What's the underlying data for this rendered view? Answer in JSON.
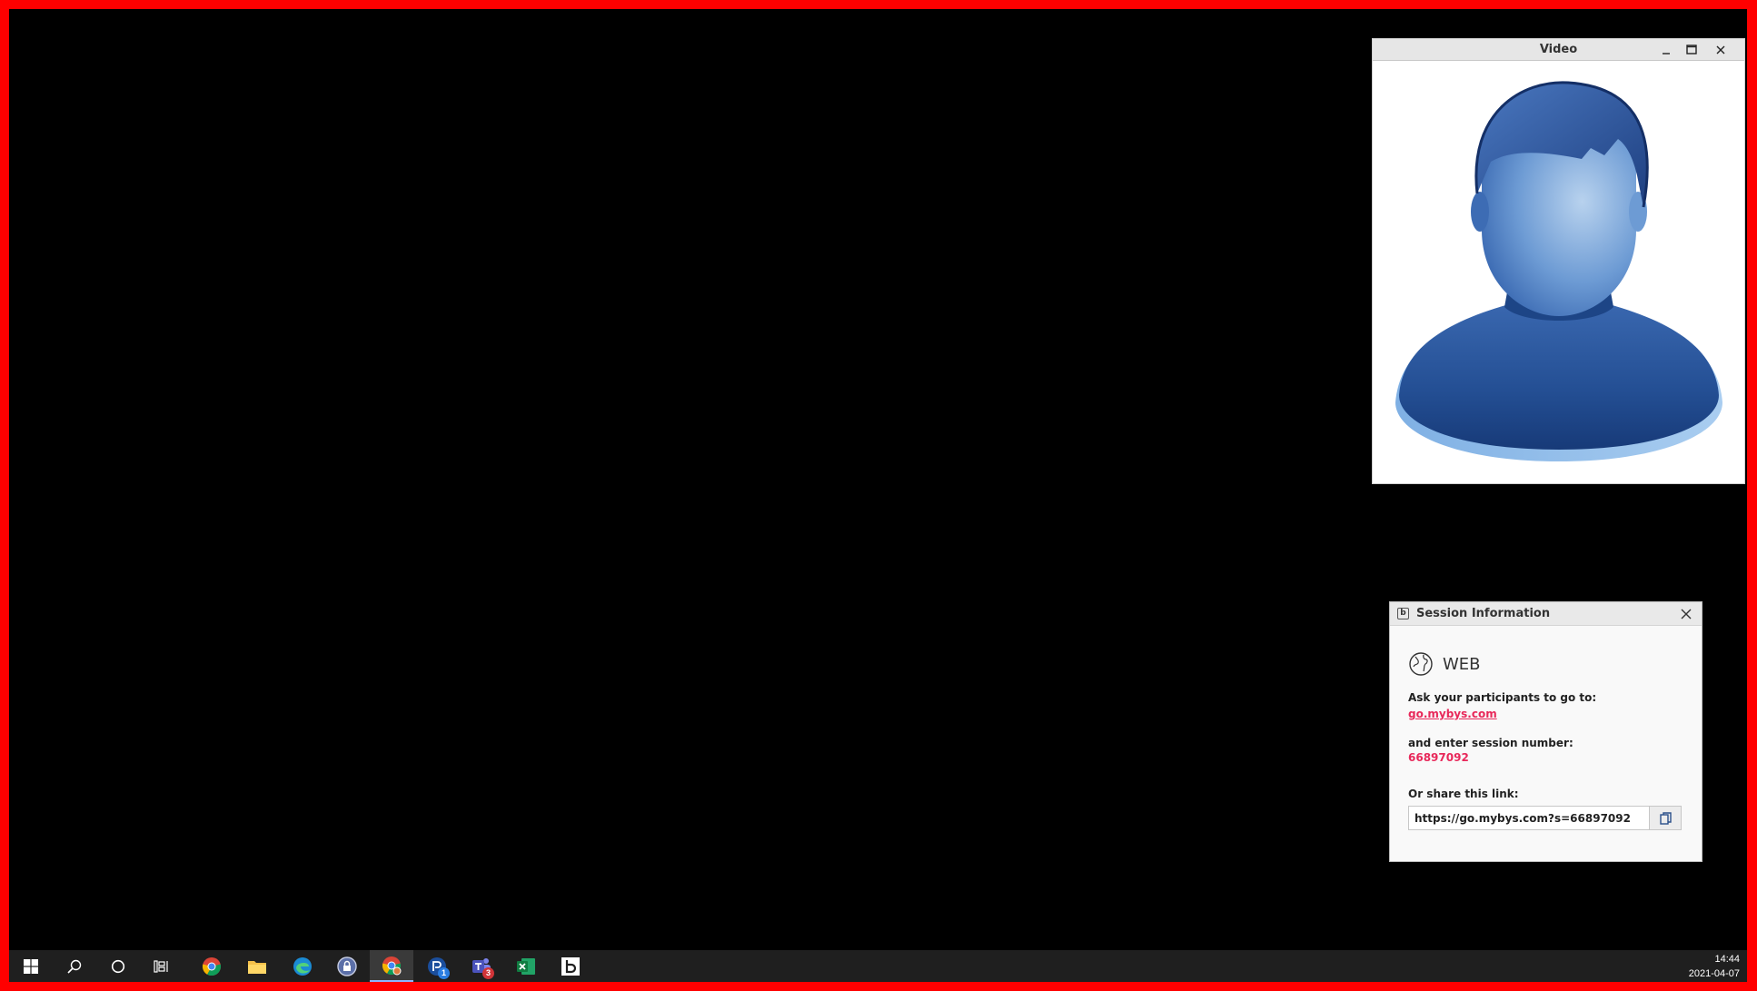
{
  "video_window": {
    "title": "Video",
    "minimize_label": "_",
    "maximize_label": "☐",
    "close_label": "✕"
  },
  "session_window": {
    "title": "Session Information",
    "app_icon_glyph": "b",
    "close_label": "✕",
    "web_label": "WEB",
    "ask_label": "Ask your participants to go to:",
    "site_link": "go.mybys.com",
    "enter_label": "and enter session number:",
    "session_number": "66897092",
    "share_label": "Or share this link:",
    "share_link": "https://go.mybys.com?s=66897092"
  },
  "taskbar": {
    "items": [
      {
        "name": "start-icon"
      },
      {
        "name": "search-icon"
      },
      {
        "name": "cortana-icon"
      },
      {
        "name": "task-view-icon"
      },
      {
        "name": "chrome-icon"
      },
      {
        "name": "file-explorer-icon"
      },
      {
        "name": "edge-icon"
      },
      {
        "name": "security-app-icon"
      },
      {
        "name": "chrome-profile-icon"
      },
      {
        "name": "remote-support-icon",
        "badge": "1"
      },
      {
        "name": "teams-icon",
        "badge": "3"
      },
      {
        "name": "excel-icon"
      },
      {
        "name": "bys-app-icon"
      }
    ],
    "time": "14:44",
    "date": "2021-04-07"
  },
  "colors": {
    "border": "#ff0000",
    "accent": "#e8285a",
    "taskbar": "#1f1f1f"
  }
}
